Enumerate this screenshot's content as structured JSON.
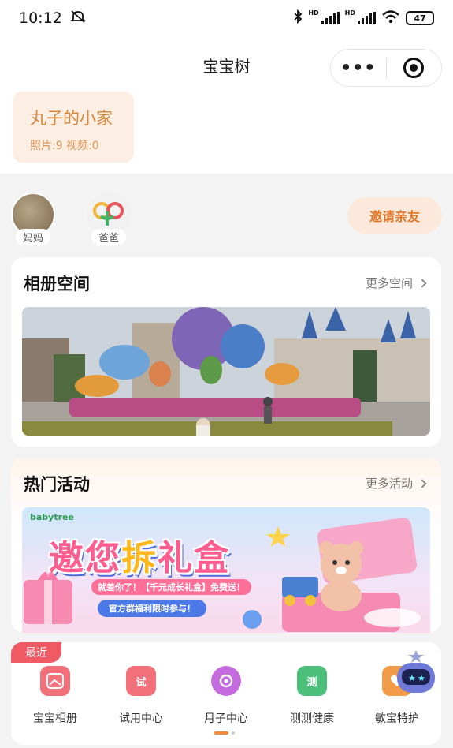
{
  "status_bar": {
    "time": "10:12",
    "network_1": "HD",
    "network_2": "HD",
    "battery": "47"
  },
  "nav": {
    "title": "宝宝树",
    "more_glyph": "•••"
  },
  "family": {
    "name": "丸子的小家",
    "stats": "照片:9 视频:0"
  },
  "members": [
    {
      "label": "妈妈"
    },
    {
      "label": "爸爸"
    }
  ],
  "invite_label": "邀请亲友",
  "album": {
    "title": "相册空间",
    "more": "更多空间"
  },
  "activity": {
    "title": "热门活动",
    "more": "更多活动",
    "banner": {
      "brand": "babytree",
      "title_part1": "邀您",
      "title_highlight": "拆",
      "title_part2": "礼盒",
      "sub1": "就差你了！【千元成长礼盒】免费送！",
      "sub2": "官方群福利限时参与！"
    }
  },
  "recent": {
    "tag": "最近",
    "items": [
      {
        "name": "宝宝相册",
        "icon": "album-icon",
        "color": "#f2707a"
      },
      {
        "name": "试用中心",
        "icon": "cart-icon",
        "color": "#f2707a",
        "glyph": "试"
      },
      {
        "name": "月子中心",
        "icon": "moon-icon",
        "color": "#c56be0"
      },
      {
        "name": "测测健康",
        "icon": "test-icon",
        "color": "#4cc07a",
        "glyph": "测"
      },
      {
        "name": "敏宝特护",
        "icon": "care-icon",
        "color": "#f29c4a"
      }
    ],
    "page_index": 1,
    "page_count": 2
  }
}
